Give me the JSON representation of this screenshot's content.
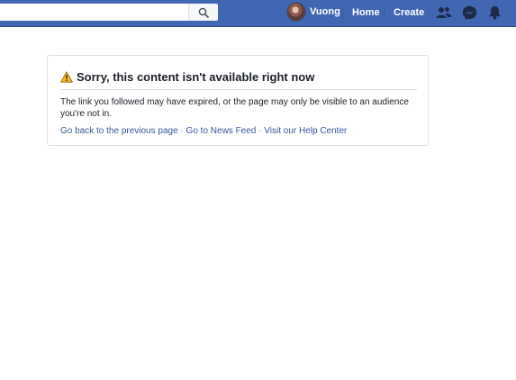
{
  "header": {
    "search_placeholder": "",
    "user_name": "Vuong",
    "home_label": "Home",
    "create_label": "Create",
    "icons": [
      "search-icon",
      "friend-requests-icon",
      "messenger-icon",
      "notifications-icon"
    ],
    "colors": {
      "bar": "#4267b2",
      "link": "#385898"
    }
  },
  "card": {
    "title": "Sorry, this content isn't available right now",
    "body_line1": "The link you followed may have expired, or the page may only be visible to an audience",
    "body_line2": "you're not in.",
    "links": [
      "Go back to the previous page",
      "Go to News Feed",
      "Visit our Help Center"
    ],
    "separator": "·"
  }
}
